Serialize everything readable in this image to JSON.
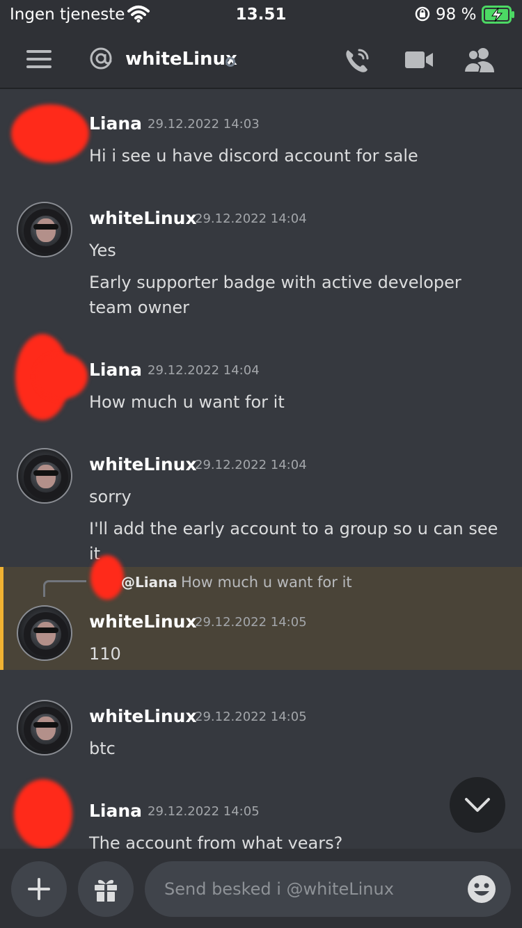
{
  "status_bar": {
    "carrier": "Ingen tjeneste",
    "time": "13.51",
    "battery_percent": "98 %"
  },
  "header": {
    "title": "whiteLinux",
    "icons": [
      "menu-icon",
      "at-icon",
      "voice-call-icon",
      "video-call-icon",
      "members-icon"
    ]
  },
  "messages": [
    {
      "author": "Liana",
      "timestamp": "29.12.2022 14:03",
      "lines": [
        "Hi i see u have discord account for sale"
      ]
    },
    {
      "author": "whiteLinux",
      "timestamp": "29.12.2022 14:04",
      "lines": [
        "Yes",
        "Early supporter badge with active developer team owner"
      ]
    },
    {
      "author": "Liana",
      "timestamp": "29.12.2022 14:04",
      "lines": [
        "How much u want for it"
      ]
    },
    {
      "author": "whiteLinux",
      "timestamp": "29.12.2022 14:04",
      "lines": [
        "sorry",
        "I'll add the early account to a group so u can see it"
      ]
    },
    {
      "author": "whiteLinux",
      "timestamp": "29.12.2022 14:05",
      "lines": [
        "110"
      ],
      "reply_to": {
        "name": "@Liana",
        "text": "How much u want for it"
      }
    },
    {
      "author": "whiteLinux",
      "timestamp": "29.12.2022 14:05",
      "lines": [
        "btc"
      ]
    },
    {
      "author": "Liana",
      "timestamp": "29.12.2022 14:05",
      "lines": [
        "The account from what years?"
      ]
    }
  ],
  "composer": {
    "placeholder": "Send besked i @whiteLinux"
  },
  "colors": {
    "background": "#36393f",
    "header": "#2f3136",
    "mention_highlight": "#4a4438",
    "mention_bar": "#f0b232",
    "battery": "#4cd964"
  }
}
